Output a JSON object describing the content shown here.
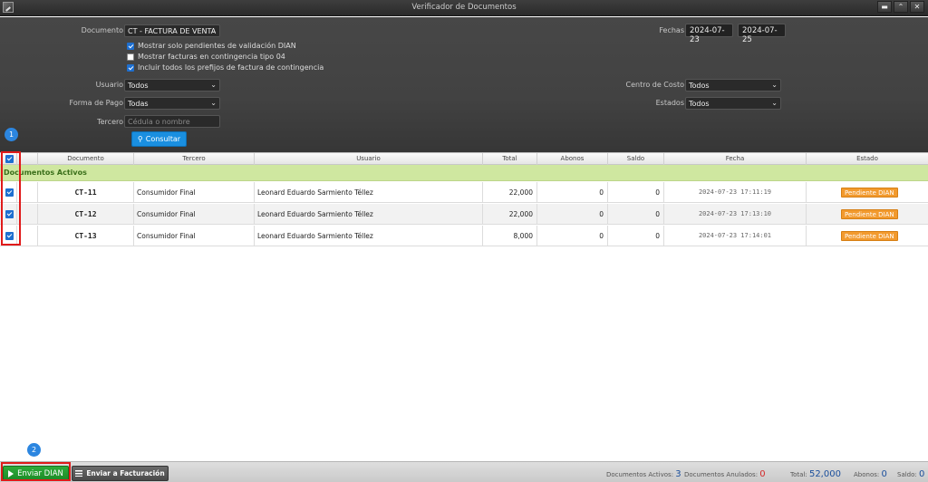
{
  "window": {
    "title": "Verificador de Documentos",
    "buttons": [
      "▬",
      "⌃",
      "✕"
    ]
  },
  "filters": {
    "documento_label": "Documento",
    "documento_value": "CT - FACTURA DE VENTA",
    "checks": [
      {
        "label": "Mostrar solo pendientes de validación DIAN",
        "checked": true
      },
      {
        "label": "Mostrar facturas en contingencia tipo 04",
        "checked": false
      },
      {
        "label": "Incluir todos los prefijos de factura de contingencia",
        "checked": true
      }
    ],
    "usuario_label": "Usuario",
    "usuario_value": "Todos",
    "forma_pago_label": "Forma de Pago",
    "forma_pago_value": "Todas",
    "tercero_label": "Tercero",
    "tercero_placeholder": "Cédula o nombre",
    "fechas_label": "Fechas",
    "fecha_desde": "2024-07-23",
    "fecha_hasta": "2024-07-25",
    "centro_costo_label": "Centro de Costo",
    "centro_costo_value": "Todos",
    "estados_label": "Estados",
    "estados_value": "Todos",
    "consultar_label": "Consultar"
  },
  "badges": {
    "one": "1",
    "two": "2"
  },
  "table": {
    "columns": [
      "Documento",
      "Tercero",
      "Usuario",
      "Total",
      "Abonos",
      "Saldo",
      "Fecha",
      "Estado"
    ],
    "group_label": "Documentos Activos",
    "rows": [
      {
        "documento": "CT-11",
        "tercero": "Consumidor Final",
        "usuario": "Leonard Eduardo Sarmiento Téllez",
        "total": "22,000",
        "abonos": "0",
        "saldo": "0",
        "fecha": "2024-07-23 17:11:19",
        "estado": "Pendiente DIAN"
      },
      {
        "documento": "CT-12",
        "tercero": "Consumidor Final",
        "usuario": "Leonard Eduardo Sarmiento Téllez",
        "total": "22,000",
        "abonos": "0",
        "saldo": "0",
        "fecha": "2024-07-23 17:13:10",
        "estado": "Pendiente DIAN"
      },
      {
        "documento": "CT-13",
        "tercero": "Consumidor Final",
        "usuario": "Leonard Eduardo Sarmiento Téllez",
        "total": "8,000",
        "abonos": "0",
        "saldo": "0",
        "fecha": "2024-07-23 17:14:01",
        "estado": "Pendiente DIAN"
      }
    ]
  },
  "footer": {
    "enviar_dian": "Enviar DIAN",
    "enviar_facturacion": "Enviar a Facturación",
    "docs_activos_label": "Documentos Activos:",
    "docs_activos_value": "3",
    "docs_anulados_label": "Documentos Anulados:",
    "docs_anulados_value": "0",
    "total_label": "Total:",
    "total_value": "52,000",
    "abonos_label": "Abonos:",
    "abonos_value": "0",
    "saldo_label": "Saldo:",
    "saldo_value": "0"
  },
  "colors": {
    "accent": "#1a8fe0",
    "status": "#f29a2e",
    "group": "#cfe7a0",
    "highlight": "#e01a1a",
    "send": "#1c8a27"
  }
}
